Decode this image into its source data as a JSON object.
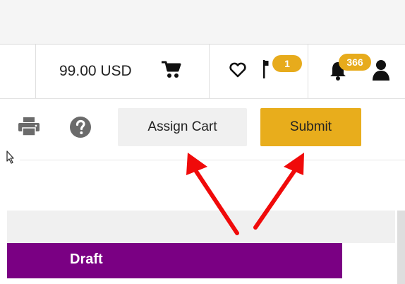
{
  "header": {
    "cart_total": "99.00 USD",
    "notifications_count": "1",
    "alerts_count": "366"
  },
  "toolbar": {
    "assign_cart_label": "Assign Cart",
    "submit_label": "Submit"
  },
  "status": {
    "label": "Draft"
  },
  "colors": {
    "accent": "#e8ad1c",
    "status_bar": "#7a0083",
    "annotation_arrow": "#f00a0a"
  },
  "icons": [
    "cart-icon",
    "heart-icon",
    "flag-icon",
    "bell-icon",
    "user-icon",
    "print-icon",
    "help-icon",
    "cursor-icon"
  ]
}
